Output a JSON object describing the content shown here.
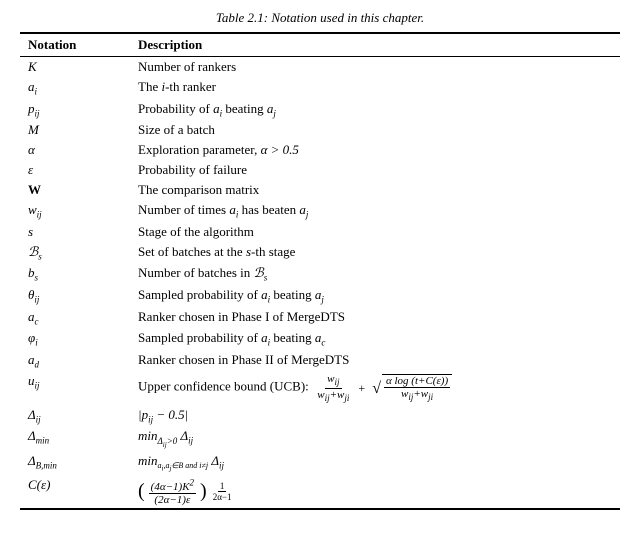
{
  "table": {
    "title": "Table 2.1: Notation used in this chapter.",
    "header": {
      "notation": "Notation",
      "description": "Description"
    },
    "rows": [
      {
        "id": "K",
        "notation_html": "<span class='math'>K</span>",
        "description": "Number of rankers"
      },
      {
        "id": "ai",
        "notation_html": "<span class='math'>a<sub class='sub'>i</sub></span>",
        "description": "The <span class='math'>i</span>-th ranker"
      },
      {
        "id": "pij",
        "notation_html": "<span class='math'>p<sub class='sub'>ij</sub></span>",
        "description": "Probability of <span class='math'>a<sub class='sub'>i</sub></span> beating <span class='math'>a<sub class='sub'>j</sub></span>"
      },
      {
        "id": "M",
        "notation_html": "<span class='math'>M</span>",
        "description": "Size of a batch"
      },
      {
        "id": "alpha",
        "notation_html": "<span class='math'>α</span>",
        "description": "Exploration parameter, <span class='math'>α &gt; 0.5</span>"
      },
      {
        "id": "epsilon",
        "notation_html": "<span class='math'>ε</span>",
        "description": "Probability of failure"
      },
      {
        "id": "W",
        "notation_html": "<span class='bold-math'>W</span>",
        "description": "The comparison matrix"
      },
      {
        "id": "wij",
        "notation_html": "<span class='math'>w<sub class='sub'>ij</sub></span>",
        "description": "Number of times <span class='math'>a<sub class='sub'>i</sub></span> has beaten <span class='math'>a<sub class='sub'>j</sub></span>"
      },
      {
        "id": "s",
        "notation_html": "<span class='math'>s</span>",
        "description": "Stage of the algorithm"
      },
      {
        "id": "Bs",
        "notation_html": "<span class='math'>&#x212C;<sub class='sub'>s</sub></span>",
        "description": "Set of batches at the <span class='math'>s</span>-th stage"
      },
      {
        "id": "bs",
        "notation_html": "<span class='math'>b<sub class='sub'>s</sub></span>",
        "description": "Number of batches in <span class='math'>&#x212C;<sub class='sub'>s</sub></span>"
      },
      {
        "id": "thetaij",
        "notation_html": "<span class='math'>θ<sub class='sub'>ij</sub></span>",
        "description": "Sampled probability of <span class='math'>a<sub class='sub'>i</sub></span> beating <span class='math'>a<sub class='sub'>j</sub></span>"
      },
      {
        "id": "ac",
        "notation_html": "<span class='math'>a<sub class='sub'>c</sub></span>",
        "description": "Ranker chosen in Phase I of MergeDTS"
      },
      {
        "id": "phii",
        "notation_html": "<span class='math'>φ<sub class='sub'>i</sub></span>",
        "description": "Sampled probability of <span class='math'>a<sub class='sub'>i</sub></span> beating <span class='math'>a<sub class='sub'>c</sub></span>"
      },
      {
        "id": "ad",
        "notation_html": "<span class='math'>a<sub class='sub'>d</sub></span>",
        "description": "Ranker chosen in Phase II of MergeDTS"
      },
      {
        "id": "uij",
        "notation_html": "<span class='math'>u<sub class='sub'>ij</sub></span>",
        "description_prefix": "Upper confidence bound (UCB):"
      },
      {
        "id": "deltaij",
        "notation_html": "<span class='math'>Δ<sub class='sub'>ij</sub></span>",
        "description": "<span class='math'>|p<sub class='sub'>ij</sub> − 0.5|</span>"
      },
      {
        "id": "deltamin",
        "notation_html": "<span class='math'>Δ<sub class='sub'>min</sub></span>",
        "description": "<span class='math'>min<sub class='sub'>Δ<sub style='font-size:7px'>ij</sub>&gt;0</sub> Δ<sub class='sub'>ij</sub></span>"
      },
      {
        "id": "deltaBmin",
        "notation_html": "<span class='math'>Δ<sub class='sub'>B,min</sub></span>",
        "description": "<span class='math'>min<sub class='sub' style='font-size:8px'>a<sub style='font-size:7px'>i</sub>,a<sub style='font-size:7px'>j</sub>∈B and i≠j</sub> Δ<sub class='sub'>ij</sub></span>"
      },
      {
        "id": "Cepsilon",
        "notation_html": "<span class='math'>C(ε)</span>",
        "description": ""
      }
    ]
  }
}
